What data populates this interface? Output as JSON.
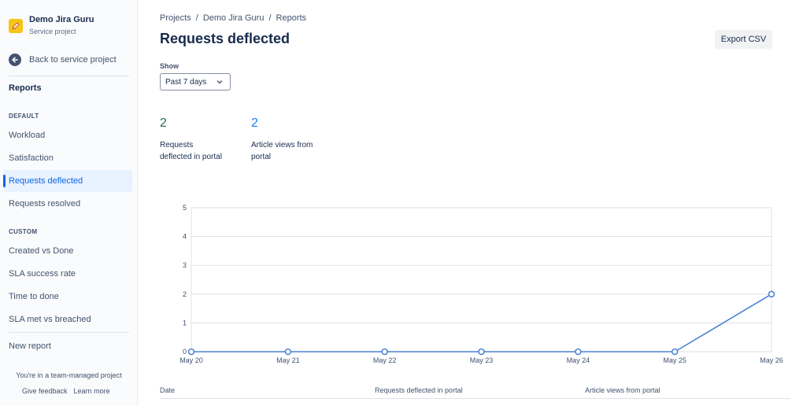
{
  "sidebar": {
    "project_name": "Demo Jira Guru",
    "project_type": "Service project",
    "back_label": "Back to service project",
    "reports_title": "Reports",
    "default_section": "DEFAULT",
    "default_items": [
      "Workload",
      "Satisfaction",
      "Requests deflected",
      "Requests resolved"
    ],
    "custom_section": "CUSTOM",
    "custom_items": [
      "Created vs Done",
      "SLA success rate",
      "Time to done",
      "SLA met vs breached"
    ],
    "new_report": "New report",
    "team_note": "You're in a team-managed project",
    "give_feedback": "Give feedback",
    "learn_more": "Learn more"
  },
  "breadcrumb": {
    "projects": "Projects",
    "project": "Demo Jira Guru",
    "current": "Reports",
    "separator": "/"
  },
  "header": {
    "title": "Requests deflected",
    "export_label": "Export CSV"
  },
  "filter": {
    "label": "Show",
    "selected": "Past 7 days"
  },
  "stats": [
    {
      "value": "2",
      "label_line1": "Requests",
      "label_line2": "deflected in portal",
      "color": "#216e4e"
    },
    {
      "value": "2",
      "label_line1": "Article views from",
      "label_line2": "portal",
      "color": "#1d7afc"
    }
  ],
  "chart_data": {
    "type": "line",
    "x": [
      "May 20",
      "May 21",
      "May 22",
      "May 23",
      "May 24",
      "May 25",
      "May 26"
    ],
    "series": [
      {
        "values": [
          0,
          0,
          0,
          0,
          0,
          0,
          2
        ],
        "color": "#4c84d4"
      }
    ],
    "yticks": [
      0,
      1,
      2,
      3,
      4,
      5
    ],
    "ylim": [
      0,
      5
    ],
    "grid": true
  },
  "table": {
    "headers": [
      "Date",
      "Requests deflected in portal",
      "Article views from portal"
    ]
  },
  "colors": {
    "accent": "#0c66e4",
    "line": "#4c84d4",
    "project_avatar": "#f5c518"
  }
}
